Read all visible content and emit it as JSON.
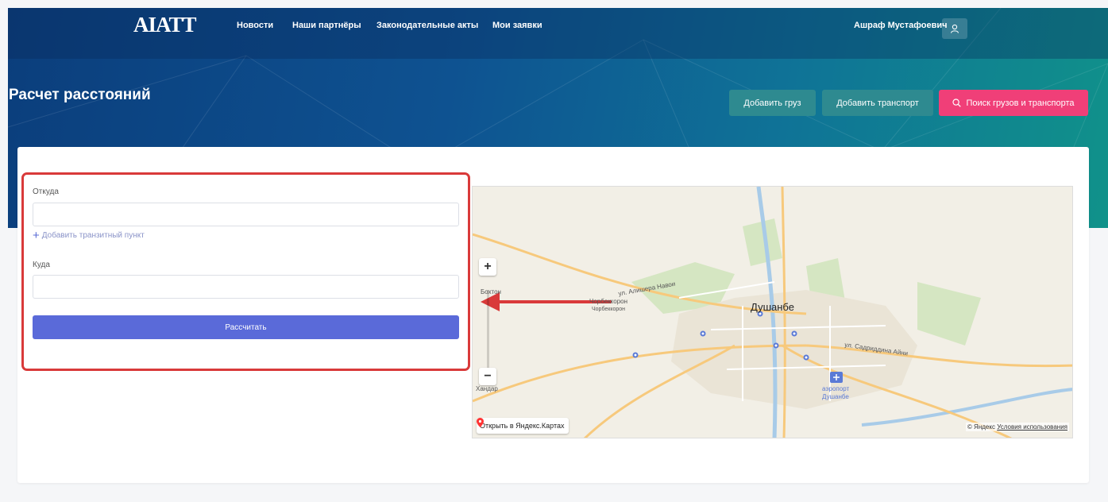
{
  "header": {
    "logo": "AIATT",
    "nav": [
      "Новости",
      "Наши партнёры",
      "Законодательные акты",
      "Мои заявки"
    ],
    "user_name": "Ашраф Мустафоевич",
    "page_title": "Расчет расстояний",
    "buttons": {
      "add_cargo": "Добавить груз",
      "add_transport": "Добавить транспорт",
      "search": "Поиск грузов и транспорта"
    }
  },
  "form": {
    "from_label": "Откуда",
    "from_value": "",
    "add_transit": "Добавить транзитный пункт",
    "to_label": "Куда",
    "to_value": "",
    "calculate_label": "Рассчитать"
  },
  "map": {
    "city": "Душанбе",
    "street_1": "ул. Алишера Навои",
    "street_2": "ул. Садриддина Айни",
    "airport_line_1": "аэропорт",
    "airport_line_2": "Душанбе",
    "place_1": "Чорбеккорон",
    "place_1_sub": "Чорбеккорон",
    "place_2": "Бохтон",
    "place_3": "Хандар",
    "open_in_maps": "Открыть в Яндекс.Картах",
    "copyright": "© Яндекс",
    "terms": "Условия использования"
  },
  "colors": {
    "accent_pink": "#f03f78",
    "button_teal": "#2e8a90",
    "calc_button": "#5a6ad9",
    "highlight_red": "#d93a3a"
  }
}
